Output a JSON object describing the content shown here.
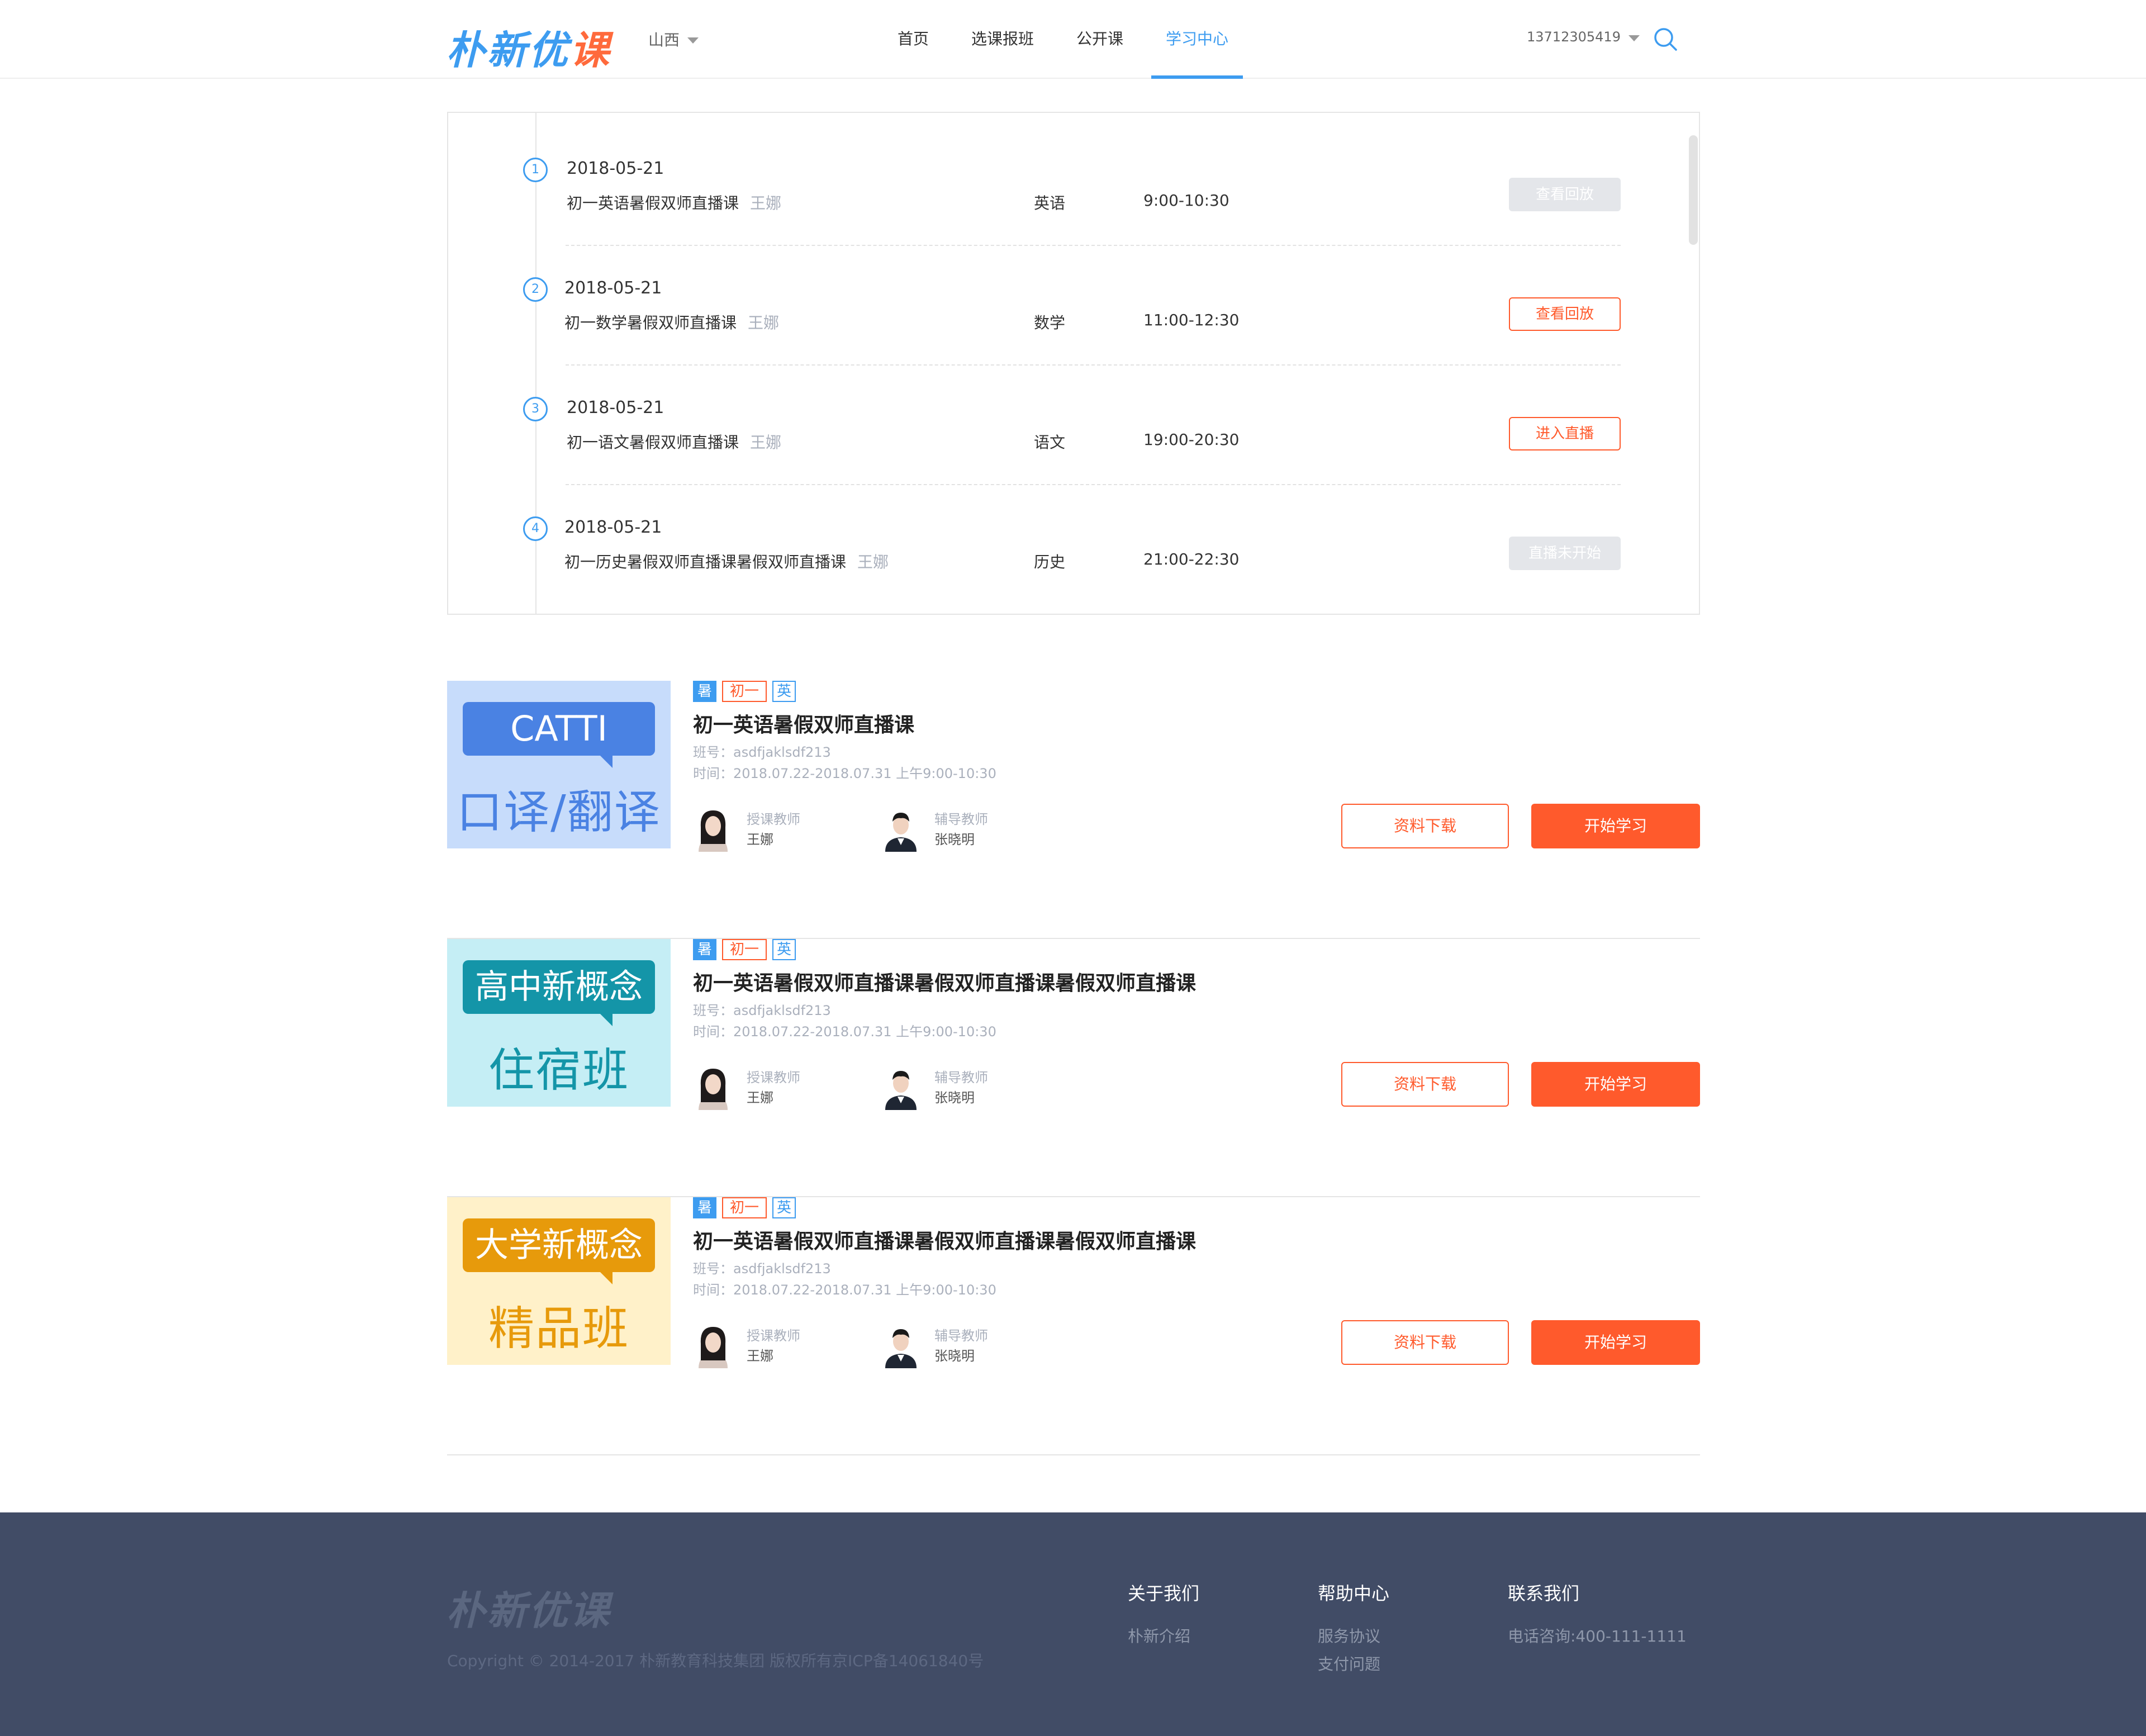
{
  "header": {
    "logo_main": "朴新优",
    "logo_accent": "课",
    "city": "山西",
    "nav": [
      "首页",
      "选课报班",
      "公开课",
      "学习中心"
    ],
    "active_nav": "学习中心",
    "phone": "13712305419",
    "accent_color": "#3d9cf0"
  },
  "schedule": {
    "rows": [
      {
        "num": "1",
        "date": "2018-05-21",
        "title": "初一英语暑假双师直播课",
        "teacher": "王娜",
        "subject": "英语",
        "time": "9:00-10:30",
        "button": "查看回放",
        "button_state": "disabled"
      },
      {
        "num": "2",
        "date": "2018-05-21",
        "title": "初一数学暑假双师直播课",
        "teacher": "王娜",
        "subject": "数学",
        "time": "11:00-12:30",
        "button": "查看回放",
        "button_state": "active"
      },
      {
        "num": "3",
        "date": "2018-05-21",
        "title": "初一语文暑假双师直播课",
        "teacher": "王娜",
        "subject": "语文",
        "time": "19:00-20:30",
        "button": "进入直播",
        "button_state": "active"
      },
      {
        "num": "4",
        "date": "2018-05-21",
        "title": "初一历史暑假双师直播课暑假双师直播课",
        "teacher": "王娜",
        "subject": "历史",
        "time": "21:00-22:30",
        "button": "直播未开始",
        "button_state": "disabled"
      }
    ]
  },
  "courses": [
    {
      "thumb_bubble": "CATTI",
      "thumb_sub": "口译/翻译",
      "tags": [
        "暑",
        "初一",
        "英"
      ],
      "title": "初一英语暑假双师直播课",
      "class_no": "班号：asdfjaklsdf213",
      "time": "时间：2018.07.22-2018.07.31 上午9:00-10:30",
      "teacher_role": "授课教师",
      "teacher_name": "王娜",
      "tutor_role": "辅导教师",
      "tutor_name": "张晓明",
      "download_label": "资料下载",
      "study_label": "开始学习"
    },
    {
      "thumb_bubble": "高中新概念",
      "thumb_sub": "住宿班",
      "tags": [
        "暑",
        "初一",
        "英"
      ],
      "title": "初一英语暑假双师直播课暑假双师直播课暑假双师直播课",
      "class_no": "班号：asdfjaklsdf213",
      "time": "时间：2018.07.22-2018.07.31 上午9:00-10:30",
      "teacher_role": "授课教师",
      "teacher_name": "王娜",
      "tutor_role": "辅导教师",
      "tutor_name": "张晓明",
      "download_label": "资料下载",
      "study_label": "开始学习"
    },
    {
      "thumb_bubble": "大学新概念",
      "thumb_sub": "精品班",
      "tags": [
        "暑",
        "初一",
        "英"
      ],
      "title": "初一英语暑假双师直播课暑假双师直播课暑假双师直播课",
      "class_no": "班号：asdfjaklsdf213",
      "time": "时间：2018.07.22-2018.07.31 上午9:00-10:30",
      "teacher_role": "授课教师",
      "teacher_name": "王娜",
      "tutor_role": "辅导教师",
      "tutor_name": "张晓明",
      "download_label": "资料下载",
      "study_label": "开始学习"
    }
  ],
  "footer": {
    "logo": "朴新优课",
    "copyright": "Copyright © 2014-2017 朴新教育科技集团 版权所有京ICP备14061840号",
    "about_title": "关于我们",
    "about_links": [
      "朴新介绍"
    ],
    "help_title": "帮助中心",
    "help_links": [
      "服务协议",
      "支付问题"
    ],
    "contact_title": "联系我们",
    "contact_links": [
      "电话咨询:400-111-1111"
    ]
  }
}
